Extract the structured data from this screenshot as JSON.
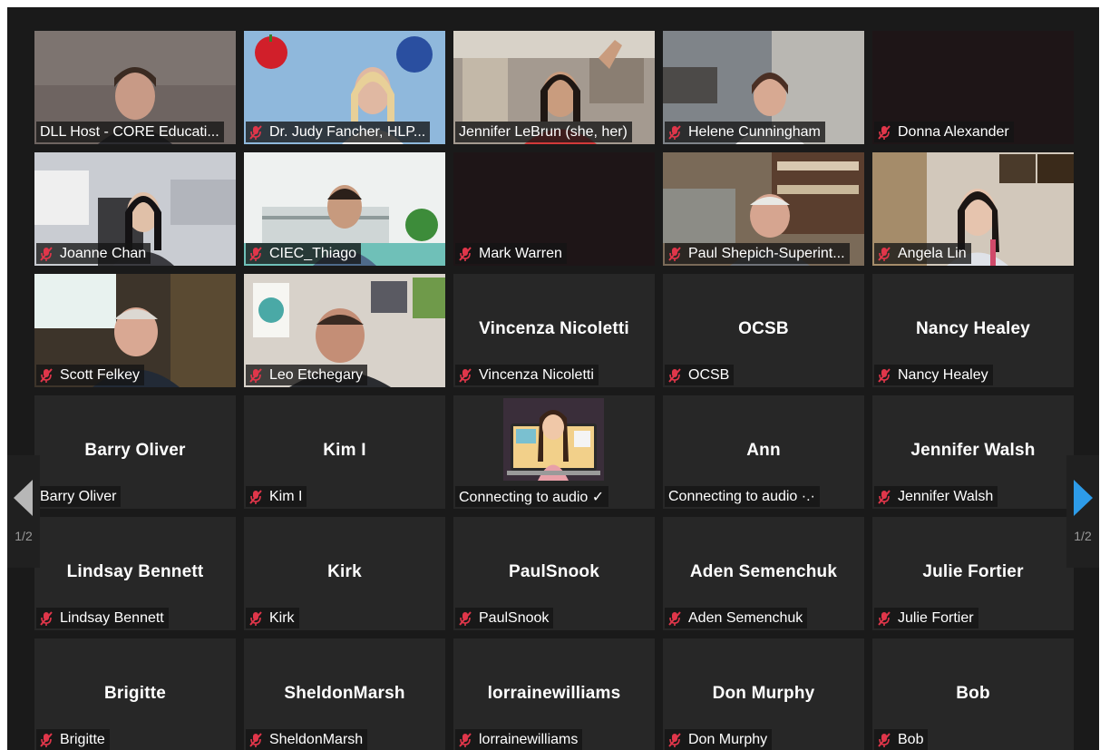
{
  "participants": [
    {
      "label": "DLL Host - CORE Educati...",
      "muted": false,
      "video": true,
      "host": true,
      "scene": "host"
    },
    {
      "label": "Dr. Judy Fancher, HLP...",
      "muted": true,
      "video": true,
      "scene": "judy"
    },
    {
      "label": "Jennifer LeBrun (she, her)",
      "muted": false,
      "video": true,
      "scene": "jennifer"
    },
    {
      "label": "Helene Cunningham",
      "muted": true,
      "video": true,
      "scene": "helene"
    },
    {
      "label": "Donna Alexander",
      "muted": true,
      "video": "dark"
    },
    {
      "label": "Joanne Chan",
      "muted": true,
      "video": true,
      "scene": "joanne"
    },
    {
      "label": "CIEC_Thiago",
      "muted": true,
      "video": true,
      "scene": "thiago"
    },
    {
      "label": "Mark Warren",
      "muted": true,
      "video": "dark"
    },
    {
      "label": "Paul Shepich-Superint...",
      "muted": true,
      "video": true,
      "scene": "paul"
    },
    {
      "label": "Angela Lin",
      "muted": true,
      "video": true,
      "scene": "angela"
    },
    {
      "label": "Scott Felkey",
      "muted": true,
      "video": true,
      "scene": "scott"
    },
    {
      "label": "Leo Etchegary",
      "muted": true,
      "video": true,
      "scene": "leo"
    },
    {
      "display": "Vincenza Nicoletti",
      "label": "Vincenza Nicoletti",
      "muted": true,
      "video": false
    },
    {
      "display": "OCSB",
      "label": "OCSB",
      "muted": true,
      "video": false
    },
    {
      "display": "Nancy Healey",
      "label": "Nancy Healey",
      "muted": true,
      "video": false
    },
    {
      "display": "Barry Oliver",
      "label": "Barry Oliver",
      "muted": false,
      "video": false
    },
    {
      "display": "Kim I",
      "label": "Kim I",
      "muted": true,
      "video": false
    },
    {
      "label": "Connecting to audio ✓",
      "muted": false,
      "video": false,
      "avatar": true
    },
    {
      "display": "Ann",
      "label": "Connecting to audio ·.·",
      "muted": false,
      "video": false
    },
    {
      "display": "Jennifer Walsh",
      "label": "Jennifer Walsh",
      "muted": true,
      "video": false
    },
    {
      "display": "Lindsay Bennett",
      "label": "Lindsay Bennett",
      "muted": true,
      "video": false
    },
    {
      "display": "Kirk",
      "label": "Kirk",
      "muted": true,
      "video": false
    },
    {
      "display": "PaulSnook",
      "label": "PaulSnook",
      "muted": true,
      "video": false
    },
    {
      "display": "Aden Semenchuk",
      "label": "Aden Semenchuk",
      "muted": true,
      "video": false
    },
    {
      "display": "Julie Fortier",
      "label": "Julie Fortier",
      "muted": true,
      "video": false
    },
    {
      "display": "Brigitte",
      "label": "Brigitte",
      "muted": true,
      "video": false
    },
    {
      "display": "SheldonMarsh",
      "label": "SheldonMarsh",
      "muted": true,
      "video": false
    },
    {
      "display": "lorrainewilliams",
      "label": "lorrainewilliams",
      "muted": true,
      "video": false
    },
    {
      "display": "Don Murphy",
      "label": "Don Murphy",
      "muted": true,
      "video": false
    },
    {
      "display": "Bob",
      "label": "Bob",
      "muted": true,
      "video": false
    }
  ],
  "pagination": {
    "left": "1/2",
    "right": "1/2"
  },
  "colors": {
    "host_border": "#c6e26f",
    "muted_icon": "#e0364a",
    "next_arrow": "#2d9be8",
    "prev_arrow": "#b7b7b7"
  },
  "icons": {
    "muted": "muted-microphone-icon",
    "prev": "previous-page-arrow-icon",
    "next": "next-page-arrow-icon"
  }
}
